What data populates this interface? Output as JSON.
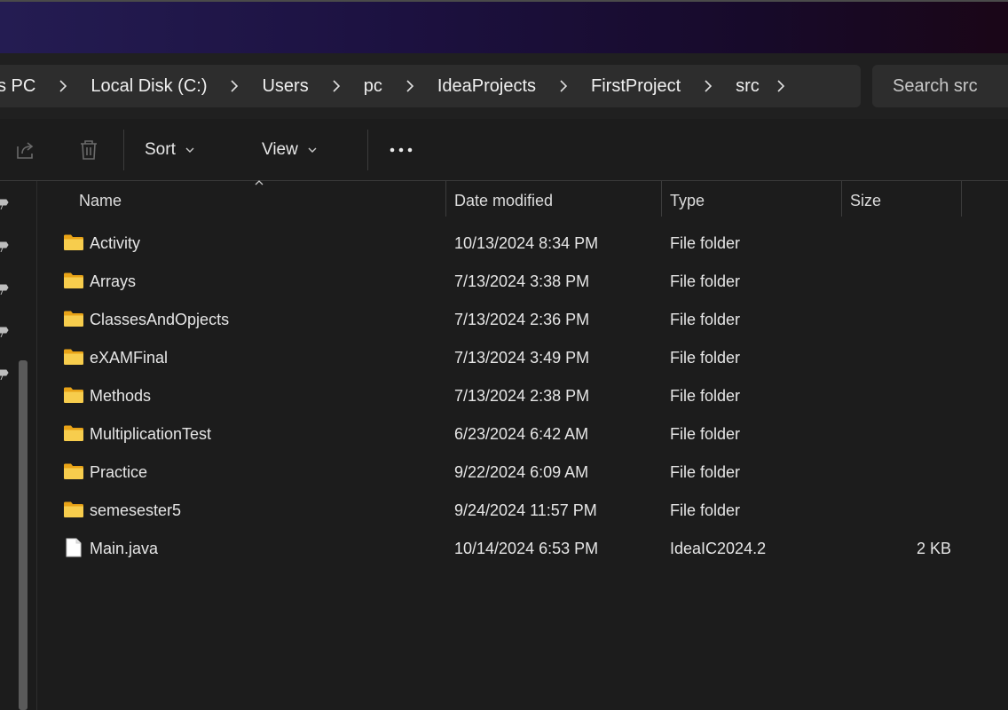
{
  "breadcrumb": {
    "items": [
      "s PC",
      "Local Disk (C:)",
      "Users",
      "pc",
      "IdeaProjects",
      "FirstProject",
      "src"
    ]
  },
  "search": {
    "placeholder": "Search src"
  },
  "toolbar": {
    "sort_label": "Sort",
    "view_label": "View"
  },
  "columns": {
    "name": "Name",
    "date": "Date modified",
    "type": "Type",
    "size": "Size"
  },
  "rows": [
    {
      "name": "Activity",
      "date": "10/13/2024 8:34 PM",
      "type": "File folder",
      "size": "",
      "icon": "folder-icon"
    },
    {
      "name": "Arrays",
      "date": "7/13/2024 3:38 PM",
      "type": "File folder",
      "size": "",
      "icon": "folder-icon"
    },
    {
      "name": "ClassesAndOpjects",
      "date": "7/13/2024 2:36 PM",
      "type": "File folder",
      "size": "",
      "icon": "folder-icon"
    },
    {
      "name": "eXAMFinal",
      "date": "7/13/2024 3:49 PM",
      "type": "File folder",
      "size": "",
      "icon": "folder-icon"
    },
    {
      "name": "Methods",
      "date": "7/13/2024 2:38 PM",
      "type": "File folder",
      "size": "",
      "icon": "folder-icon"
    },
    {
      "name": "MultiplicationTest",
      "date": "6/23/2024 6:42 AM",
      "type": "File folder",
      "size": "",
      "icon": "folder-icon"
    },
    {
      "name": "Practice",
      "date": "9/22/2024 6:09 AM",
      "type": "File folder",
      "size": "",
      "icon": "folder-icon"
    },
    {
      "name": "semesester5",
      "date": "9/24/2024 11:57 PM",
      "type": "File folder",
      "size": "",
      "icon": "folder-icon"
    },
    {
      "name": "Main.java",
      "date": "10/14/2024 6:53 PM",
      "type": "IdeaIC2024.2",
      "size": "2 KB",
      "icon": "file-icon"
    }
  ],
  "colors": {
    "background": "#1c1c1c",
    "titlebar_gradient": [
      "#241c52",
      "#1a0617"
    ],
    "folder": "#f4c542"
  }
}
